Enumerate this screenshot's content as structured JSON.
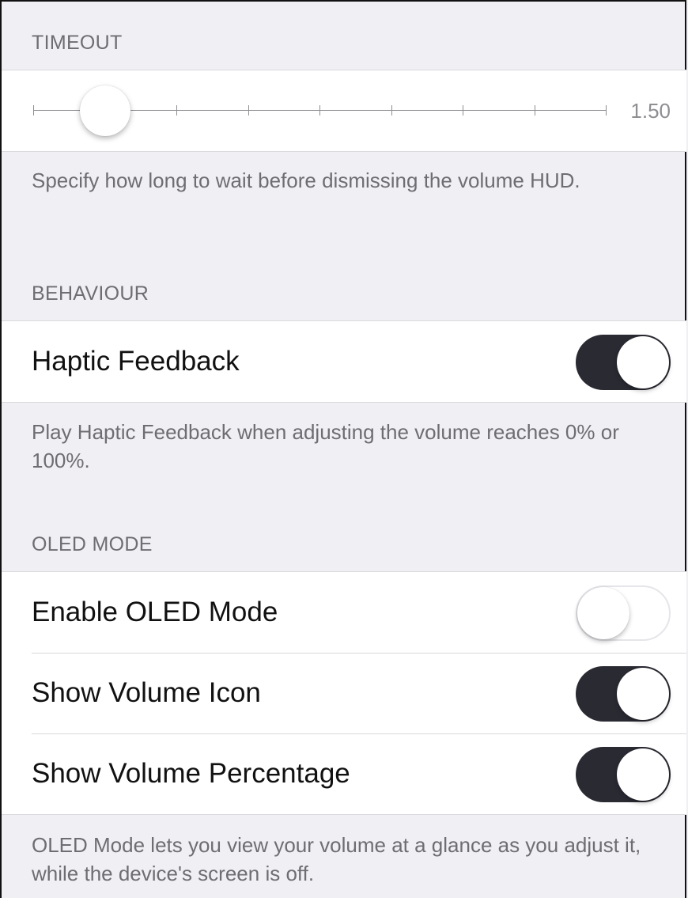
{
  "timeout": {
    "header": "TIMEOUT",
    "slider": {
      "value_label": "1.50",
      "position_fraction": 0.125,
      "tick_count": 9
    },
    "footer": "Specify how long to wait before dismissing the volume HUD."
  },
  "behaviour": {
    "header": "BEHAVIOUR",
    "rows": [
      {
        "label": "Haptic Feedback",
        "state": "on"
      }
    ],
    "footer": "Play Haptic Feedback when adjusting the volume reaches 0% or 100%."
  },
  "oled": {
    "header": "OLED MODE",
    "rows": [
      {
        "label": "Enable OLED Mode",
        "state": "off"
      },
      {
        "label": "Show Volume Icon",
        "state": "on"
      },
      {
        "label": "Show Volume Percentage",
        "state": "on"
      }
    ],
    "footer": "OLED Mode lets you view your volume at a glance as you adjust it, while the device's screen is off."
  },
  "colors": {
    "background": "#efeff4",
    "toggle_on": "#2a2a33",
    "secondary_text": "#6d6d72"
  }
}
